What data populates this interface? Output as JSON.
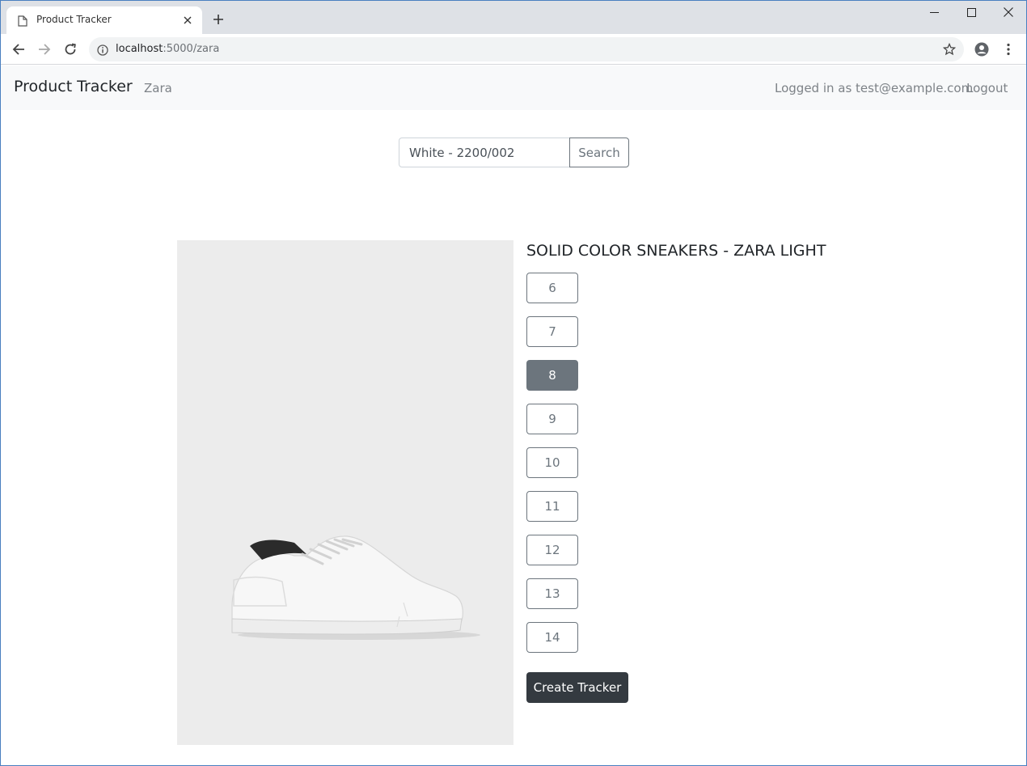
{
  "browser": {
    "tab_title": "Product Tracker",
    "url_host": "localhost",
    "url_path": ":5000/zara"
  },
  "navbar": {
    "brand": "Product Tracker",
    "link_zara": "Zara",
    "logged_in_text": "Logged in as test@example.com",
    "logout": "Logout"
  },
  "search": {
    "value": "White - 2200/002",
    "button": "Search"
  },
  "product": {
    "title": "SOLID COLOR SNEAKERS - ZARA LIGHT",
    "sizes": [
      "6",
      "7",
      "8",
      "9",
      "10",
      "11",
      "12",
      "13",
      "14"
    ],
    "selected_size": "8",
    "create_button": "Create Tracker"
  },
  "colors": {
    "selected_size": "#6c757d",
    "create_button": "#343a40",
    "navbar_bg": "#f8f9fa"
  }
}
